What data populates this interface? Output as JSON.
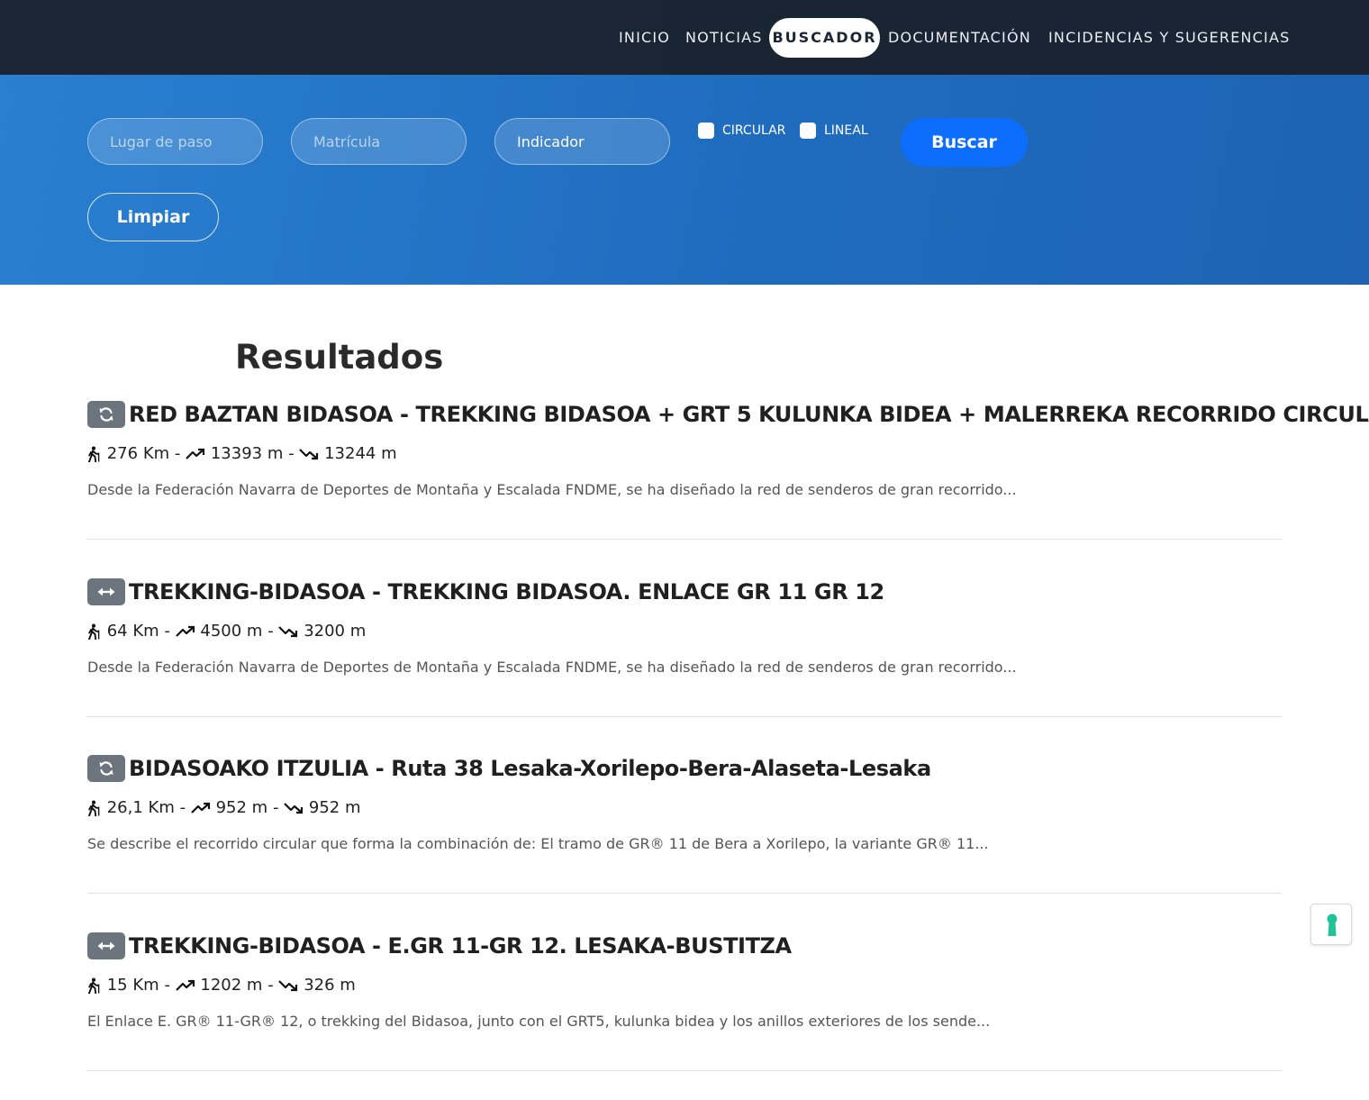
{
  "nav": {
    "items": [
      {
        "label": "INICIO",
        "active": false
      },
      {
        "label": "NOTICIAS",
        "active": false
      },
      {
        "label": "BUSCADOR",
        "active": true
      },
      {
        "label": "DOCUMENTACIÓN",
        "active": false
      },
      {
        "label": "INCIDENCIAS Y SUGERENCIAS",
        "active": false
      }
    ]
  },
  "search": {
    "lugar_placeholder": "Lugar de paso",
    "matricula_placeholder": "Matrícula",
    "indicador_placeholder": "Indicador",
    "circular_label": "CIRCULAR",
    "circular_checked": false,
    "lineal_label": "LINEAL",
    "lineal_checked": false,
    "search_button": "Buscar",
    "clear_button": "Limpiar"
  },
  "results": {
    "title": "Resultados",
    "items": [
      {
        "type_icon": "circular-refresh-icon",
        "title": "RED BAZTAN BIDASOA - TREKKING BIDASOA + GRT 5 KULUNKA BIDEA + MALERREKA RECORRIDO CIRCULAR",
        "distance": "276 Km",
        "ascent": "13393 m",
        "descent": "13244 m",
        "description": "Desde la Federación Navarra de Deportes de Montaña y Escalada FNDME, se ha diseñado la red de senderos de gran recorrido..."
      },
      {
        "type_icon": "linear-arrows-icon",
        "title": "TREKKING-BIDASOA - TREKKING BIDASOA. ENLACE GR 11 GR 12",
        "distance": "64 Km",
        "ascent": "4500 m",
        "descent": "3200 m",
        "description": "Desde la Federación Navarra de Deportes de Montaña y Escalada FNDME, se ha diseñado la red de senderos de gran recorrido..."
      },
      {
        "type_icon": "circular-refresh-icon",
        "title": "BIDASOAKO ITZULIA - Ruta 38 Lesaka-Xorilepo-Bera-Alaseta-Lesaka",
        "distance": "26,1 Km",
        "ascent": "952 m",
        "descent": "952 m",
        "description": "Se describe el recorrido circular que forma la combinación de: El tramo de GR® 11 de Bera a Xorilepo, la variante GR® 11..."
      },
      {
        "type_icon": "linear-arrows-icon",
        "title": "TREKKING-BIDASOA - E.GR 11-GR 12. LESAKA-BUSTITZA",
        "distance": "15 Km",
        "ascent": "1202 m",
        "descent": "326 m",
        "description": "El Enlace E. GR® 11-GR® 12, o trekking del Bidasoa, junto con el GRT5, kulunka bidea y los anillos exteriores de los sende..."
      }
    ]
  },
  "stat_separator": "-",
  "colors": {
    "nav_bg": "#1b2636",
    "search_band": "#1f6cbf",
    "primary_button": "#0d6efd",
    "badge": "#6c757d",
    "accessibility_icon": "#1fc29a"
  }
}
